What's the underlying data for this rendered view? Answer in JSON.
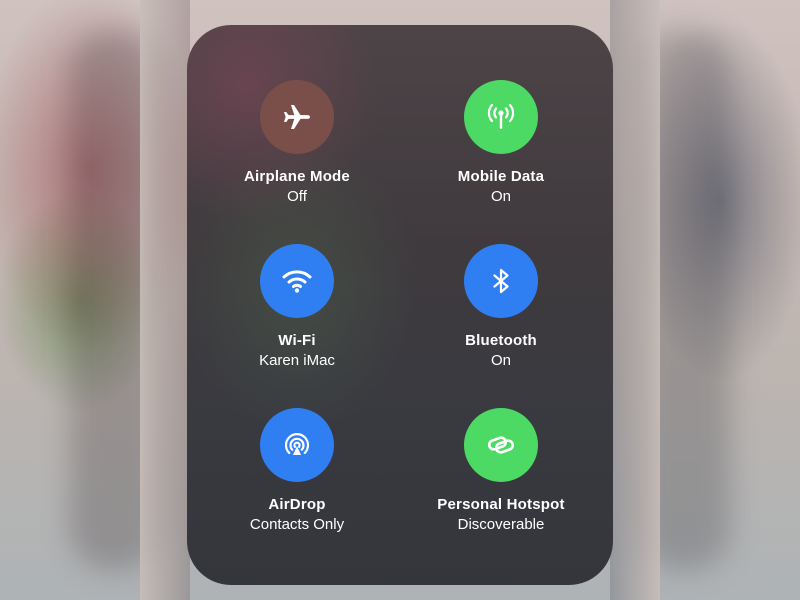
{
  "colors": {
    "off": "#7a4f49",
    "green": "#4cd964",
    "blue": "#2f7ff3"
  },
  "toggles": [
    {
      "label": "Airplane Mode",
      "status": "Off",
      "icon": "airplane-icon",
      "state": "off"
    },
    {
      "label": "Mobile Data",
      "status": "On",
      "icon": "antenna-icon",
      "state": "on"
    },
    {
      "label": "Wi-Fi",
      "status": "Karen iMac",
      "icon": "wifi-icon",
      "state": "on"
    },
    {
      "label": "Bluetooth",
      "status": "On",
      "icon": "bluetooth-icon",
      "state": "on"
    },
    {
      "label": "AirDrop",
      "status": "Contacts Only",
      "icon": "airdrop-icon",
      "state": "on"
    },
    {
      "label": "Personal Hotspot",
      "status": "Discoverable",
      "icon": "hotspot-link-icon",
      "state": "on"
    }
  ]
}
